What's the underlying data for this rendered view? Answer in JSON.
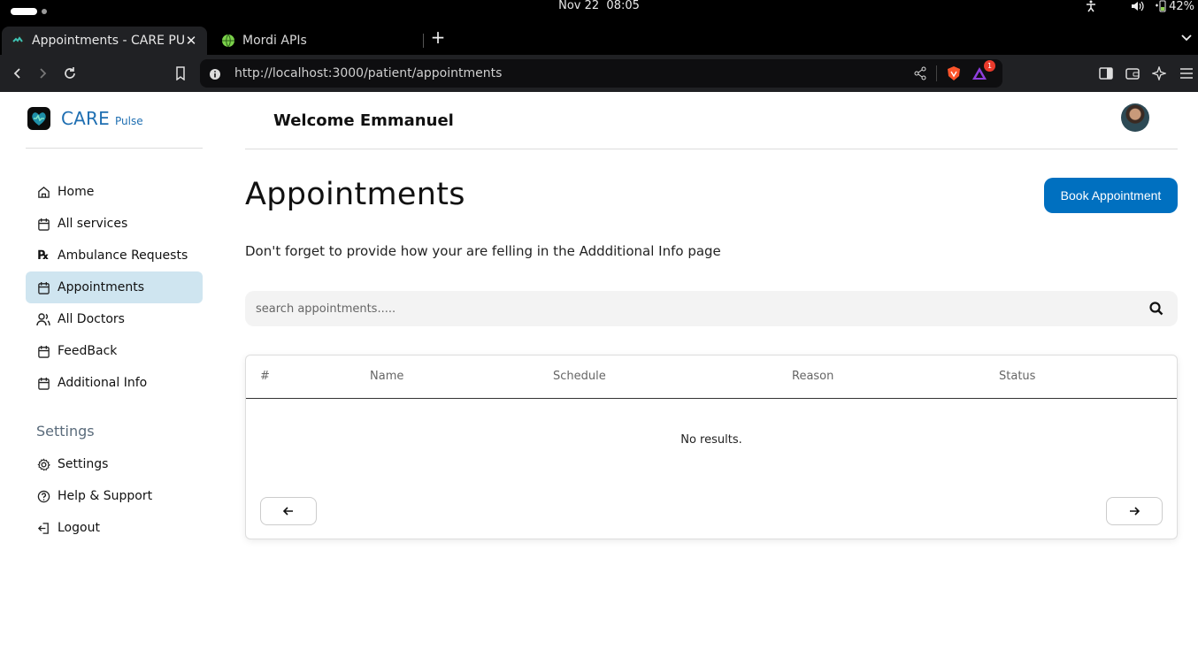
{
  "os": {
    "date": "Nov 22",
    "time": "08:05",
    "battery": "42%"
  },
  "browser": {
    "tabs": [
      {
        "title": "Appointments - CARE PULSE",
        "active": true
      },
      {
        "title": "Mordi APIs",
        "active": false
      }
    ],
    "url": "http://localhost:3000/patient/appointments",
    "badge_count": "1"
  },
  "brand": {
    "name": "CARE",
    "sub": "Pulse"
  },
  "sidebar": {
    "items": [
      {
        "label": "Home",
        "icon": "home-icon"
      },
      {
        "label": "All services",
        "icon": "calendar-icon"
      },
      {
        "label": "Ambulance Requests",
        "icon": "prescription-icon"
      },
      {
        "label": "Appointments",
        "icon": "calendar-icon",
        "active": true
      },
      {
        "label": "All Doctors",
        "icon": "users-icon"
      },
      {
        "label": "FeedBack",
        "icon": "calendar-icon"
      },
      {
        "label": "Additional Info",
        "icon": "calendar-icon"
      }
    ],
    "settings_heading": "Settings",
    "settings_items": [
      {
        "label": "Settings",
        "icon": "gear-icon"
      },
      {
        "label": "Help & Support",
        "icon": "help-icon"
      },
      {
        "label": "Logout",
        "icon": "logout-icon"
      }
    ]
  },
  "header": {
    "welcome": "Welcome Emmanuel"
  },
  "main": {
    "title": "Appointments",
    "book_button": "Book Appointment",
    "subtitle": "Don't forget to provide how your are felling in the Addditional Info page",
    "search_placeholder": "search appointments.....",
    "table": {
      "columns": [
        "#",
        "Name",
        "Schedule",
        "Reason",
        "Status"
      ],
      "empty_text": "No results."
    }
  },
  "colors": {
    "accent": "#0070c0",
    "active_nav": "#cfe5f0",
    "brand": "#1f6fb2"
  }
}
